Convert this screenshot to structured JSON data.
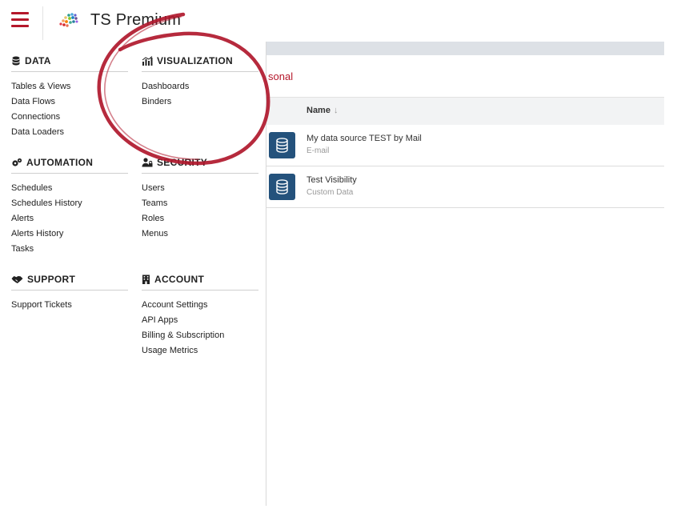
{
  "header": {
    "title": "TS Premium"
  },
  "menu": {
    "data": {
      "title": "DATA",
      "items": [
        "Tables & Views",
        "Data Flows",
        "Connections",
        "Data Loaders"
      ]
    },
    "visualization": {
      "title": "VISUALIZATION",
      "items": [
        "Dashboards",
        "Binders"
      ]
    },
    "automation": {
      "title": "AUTOMATION",
      "items": [
        "Schedules",
        "Schedules History",
        "Alerts",
        "Alerts History",
        "Tasks"
      ]
    },
    "security": {
      "title": "SECURITY",
      "items": [
        "Users",
        "Teams",
        "Roles",
        "Menus"
      ]
    },
    "support": {
      "title": "SUPPORT",
      "items": [
        "Support Tickets"
      ]
    },
    "account": {
      "title": "ACCOUNT",
      "items": [
        "Account Settings",
        "API Apps",
        "Billing & Subscription",
        "Usage Metrics"
      ]
    }
  },
  "main": {
    "filter_label": "sonal",
    "column_name": "Name",
    "sort_indicator": "↓",
    "rows": [
      {
        "title": "My data source TEST by Mail",
        "subtitle": "E-mail"
      },
      {
        "title": "Test Visibility",
        "subtitle": "Custom Data"
      }
    ]
  },
  "colors": {
    "accent": "#b5172a",
    "db_icon_bg": "#24527c",
    "annotation": "#b0182c"
  },
  "icons": {
    "menu": "hamburger-icon",
    "logo": "logo-icon",
    "data": "database-icon",
    "visualization": "chart-icon",
    "automation": "gears-icon",
    "security": "users-lock-icon",
    "support": "handshake-icon",
    "account": "building-icon",
    "row": "database-icon"
  }
}
